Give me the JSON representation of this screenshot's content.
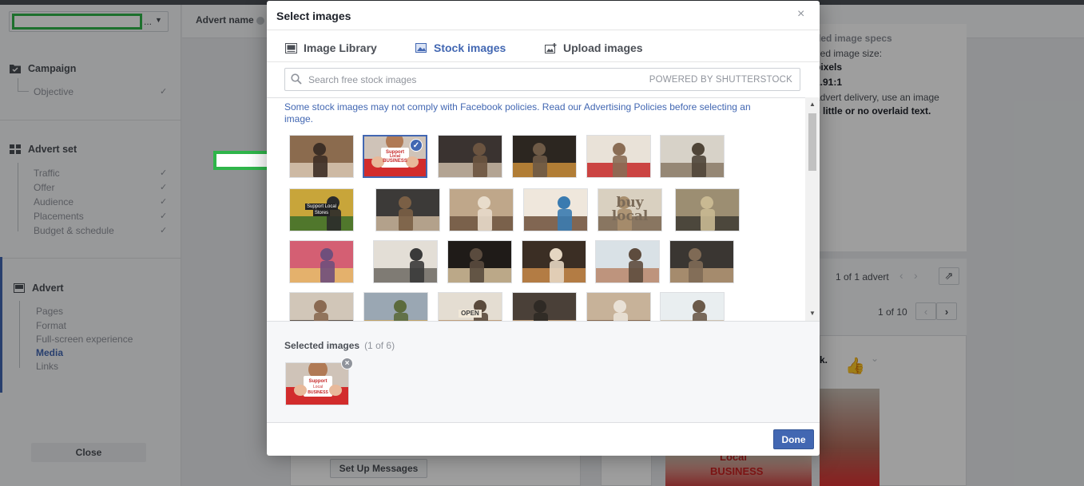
{
  "background": {
    "account_selector": {
      "suffix": "..."
    },
    "advert_name_label": "Advert name",
    "sidebar": {
      "sections": [
        {
          "title": "Campaign",
          "items": [
            "Objective"
          ]
        },
        {
          "title": "Advert set",
          "items": [
            "Traffic",
            "Offer",
            "Audience",
            "Placements",
            "Budget & schedule"
          ]
        },
        {
          "title": "Advert",
          "items": [
            "Pages",
            "Format",
            "Full-screen experience",
            "Media",
            "Links"
          ],
          "active_item": "Media"
        }
      ],
      "close_label": "Close"
    },
    "specs": {
      "heading": "ded image specs",
      "line1": "ded image size:",
      "line2": "pixels",
      "line3": "1.91:1",
      "line4": "advert delivery, use an image",
      "line5": "s little or no overlaid text."
    },
    "pager_advert": "1 of 1 advert",
    "pager_preview": "1 of 10",
    "preview_fragment": "k.",
    "setup_messages_label": "Set Up Messages",
    "preview_image_text": [
      "Local",
      "BUSINESS"
    ]
  },
  "modal": {
    "title": "Select images",
    "tabs": [
      {
        "label": "Image Library",
        "icon": "image-library-icon",
        "active": false
      },
      {
        "label": "Stock images",
        "icon": "stock-images-icon",
        "active": true
      },
      {
        "label": "Upload images",
        "icon": "upload-images-icon",
        "active": false
      }
    ],
    "search": {
      "placeholder": "Search free stock images",
      "value": "",
      "powered_by": "POWERED BY SHUTTERSTOCK"
    },
    "notice": "Some stock images may not comply with Facebook policies. Read our Advertising Policies before selecting an image.",
    "image_rows": [
      [
        {
          "desc": "shop-owner-counter",
          "selected": false
        },
        {
          "desc": "support-local-business-sign",
          "selected": true,
          "caption": [
            "Support",
            "Local",
            "BUSINESS"
          ]
        },
        {
          "desc": "shop-team-arms-crossed",
          "selected": false
        },
        {
          "desc": "deli-owner-doorway",
          "selected": false
        },
        {
          "desc": "butcher-counter",
          "selected": false
        },
        {
          "desc": "boutique-owner",
          "selected": false
        }
      ],
      [
        {
          "desc": "support-local-phone",
          "selected": false,
          "caption": [
            "Support Local",
            "Stores"
          ]
        },
        {
          "desc": "coffee-roaster",
          "selected": false
        },
        {
          "desc": "cafe-couple",
          "selected": false
        },
        {
          "desc": "bakery-owner",
          "selected": false
        },
        {
          "desc": "buy-local-letterpress",
          "selected": false,
          "caption": [
            "buy",
            "local"
          ]
        },
        {
          "desc": "grocery-shop-interior",
          "selected": false
        }
      ],
      [
        {
          "desc": "market-bokeh",
          "selected": false
        },
        {
          "desc": "workshop-counter",
          "selected": false
        },
        {
          "desc": "deli-entrance",
          "selected": false
        },
        {
          "desc": "coffee-shop-barista",
          "selected": false
        },
        {
          "desc": "handshake-customer",
          "selected": false
        },
        {
          "desc": "roastery-worker",
          "selected": false
        }
      ],
      [
        {
          "desc": "team-in-store",
          "selected": false
        },
        {
          "desc": "outdoor-seniors",
          "selected": false
        },
        {
          "desc": "open-sign-owner",
          "selected": false,
          "caption": [
            "OPEN"
          ]
        },
        {
          "desc": "cafe-bearded-man",
          "selected": false
        },
        {
          "desc": "bakery-smiling-woman",
          "selected": false
        },
        {
          "desc": "bright-shop-interior",
          "selected": false
        }
      ]
    ],
    "selected": {
      "title": "Selected images",
      "count": "(1 of 6)",
      "caption": [
        "Support",
        "Local",
        "BUSINESS"
      ]
    },
    "done_label": "Done"
  }
}
